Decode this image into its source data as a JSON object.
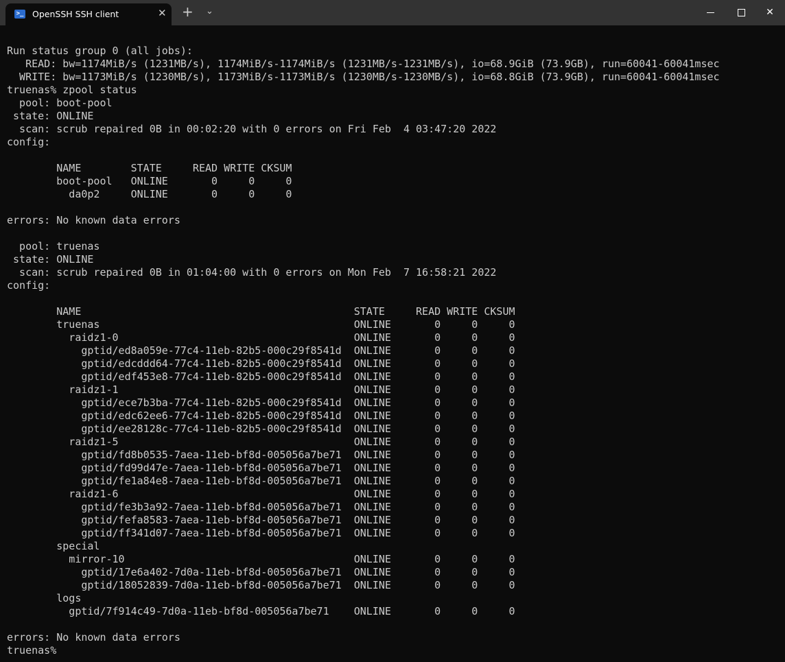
{
  "window": {
    "tab_title": "OpenSSH SSH client",
    "tab_icon": "powershell-icon",
    "close_tab_icon": "close-icon",
    "new_tab_icon": "plus-icon",
    "dropdown_icon": "chevron-down-icon",
    "controls": [
      "minimize-icon",
      "maximize-icon",
      "close-icon"
    ]
  },
  "colors": {
    "background": "#0c0c0c",
    "text": "#cccccc",
    "titlebar": "#333333"
  },
  "terminal": {
    "lines": [
      "",
      "Run status group 0 (all jobs):",
      "   READ: bw=1174MiB/s (1231MB/s), 1174MiB/s-1174MiB/s (1231MB/s-1231MB/s), io=68.9GiB (73.9GB), run=60041-60041msec",
      "  WRITE: bw=1173MiB/s (1230MB/s), 1173MiB/s-1173MiB/s (1230MB/s-1230MB/s), io=68.8GiB (73.9GB), run=60041-60041msec",
      "truenas% zpool status",
      "  pool: boot-pool",
      " state: ONLINE",
      "  scan: scrub repaired 0B in 00:02:20 with 0 errors on Fri Feb  4 03:47:20 2022",
      "config:",
      "",
      "        NAME        STATE     READ WRITE CKSUM",
      "        boot-pool   ONLINE       0     0     0",
      "          da0p2     ONLINE       0     0     0",
      "",
      "errors: No known data errors",
      "",
      "  pool: truenas",
      " state: ONLINE",
      "  scan: scrub repaired 0B in 01:04:00 with 0 errors on Mon Feb  7 16:58:21 2022",
      "config:",
      "",
      "        NAME                                            STATE     READ WRITE CKSUM",
      "        truenas                                         ONLINE       0     0     0",
      "          raidz1-0                                      ONLINE       0     0     0",
      "            gptid/ed8a059e-77c4-11eb-82b5-000c29f8541d  ONLINE       0     0     0",
      "            gptid/edcddd64-77c4-11eb-82b5-000c29f8541d  ONLINE       0     0     0",
      "            gptid/edf453e8-77c4-11eb-82b5-000c29f8541d  ONLINE       0     0     0",
      "          raidz1-1                                      ONLINE       0     0     0",
      "            gptid/ece7b3ba-77c4-11eb-82b5-000c29f8541d  ONLINE       0     0     0",
      "            gptid/edc62ee6-77c4-11eb-82b5-000c29f8541d  ONLINE       0     0     0",
      "            gptid/ee28128c-77c4-11eb-82b5-000c29f8541d  ONLINE       0     0     0",
      "          raidz1-5                                      ONLINE       0     0     0",
      "            gptid/fd8b0535-7aea-11eb-bf8d-005056a7be71  ONLINE       0     0     0",
      "            gptid/fd99d47e-7aea-11eb-bf8d-005056a7be71  ONLINE       0     0     0",
      "            gptid/fe1a84e8-7aea-11eb-bf8d-005056a7be71  ONLINE       0     0     0",
      "          raidz1-6                                      ONLINE       0     0     0",
      "            gptid/fe3b3a92-7aea-11eb-bf8d-005056a7be71  ONLINE       0     0     0",
      "            gptid/fefa8583-7aea-11eb-bf8d-005056a7be71  ONLINE       0     0     0",
      "            gptid/ff341d07-7aea-11eb-bf8d-005056a7be71  ONLINE       0     0     0",
      "        special",
      "          mirror-10                                     ONLINE       0     0     0",
      "            gptid/17e6a402-7d0a-11eb-bf8d-005056a7be71  ONLINE       0     0     0",
      "            gptid/18052839-7d0a-11eb-bf8d-005056a7be71  ONLINE       0     0     0",
      "        logs",
      "          gptid/7f914c49-7d0a-11eb-bf8d-005056a7be71    ONLINE       0     0     0",
      "",
      "errors: No known data errors",
      "truenas% "
    ]
  }
}
